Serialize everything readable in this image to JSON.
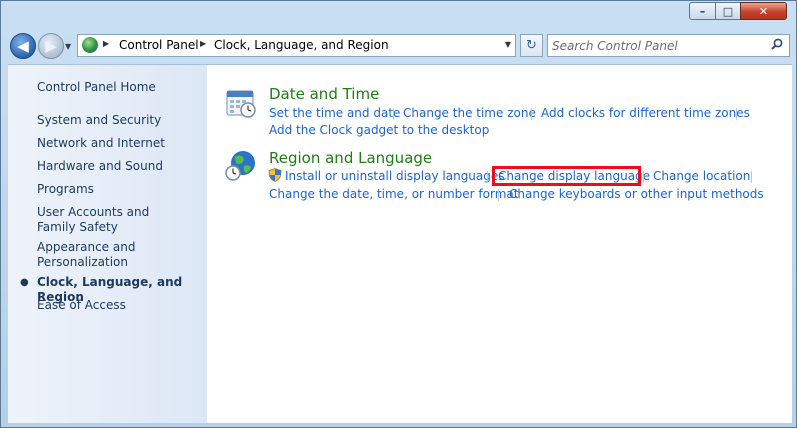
{
  "window": {
    "controls": {
      "minimize": "–",
      "maximize": "□",
      "close": "✕"
    }
  },
  "navigation": {
    "back_icon": "◀",
    "forward_icon": "▶",
    "address": {
      "crumbs": [
        "Control Panel",
        "Clock, Language, and Region"
      ],
      "separator": "▶",
      "dropdown": "▼"
    },
    "refresh_icon": "↻",
    "search": {
      "placeholder": "Search Control Panel"
    }
  },
  "sidebar": {
    "home": "Control Panel Home",
    "items": [
      {
        "label": "System and Security"
      },
      {
        "label": "Network and Internet"
      },
      {
        "label": "Hardware and Sound"
      },
      {
        "label": "Programs"
      },
      {
        "label": "User Accounts and Family Safety"
      },
      {
        "label": "Appearance and Personalization"
      },
      {
        "label": "Clock, Language, and Region",
        "current": true
      },
      {
        "label": "Ease of Access"
      }
    ],
    "bullet": "●"
  },
  "categories": [
    {
      "title": "Date and Time",
      "links": [
        "Set the time and date",
        "Change the time zone",
        "Add clocks for different time zones",
        "Add the Clock gadget to the desktop"
      ]
    },
    {
      "title": "Region and Language",
      "links": [
        "Install or uninstall display languages",
        "Change display language",
        "Change location",
        "Change the date, time, or number format",
        "Change keyboards or other input methods"
      ]
    }
  ],
  "colors": {
    "highlight": "#e8101e",
    "link": "#1e63c8",
    "category_title": "#1e7e12"
  }
}
